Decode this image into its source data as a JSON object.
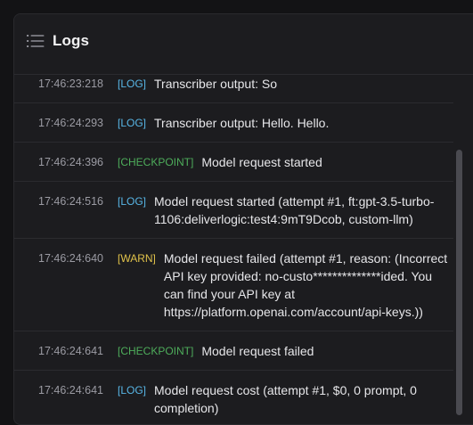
{
  "panel": {
    "title": "Logs",
    "icon": "list-icon"
  },
  "colors": {
    "log": "#58b6e6",
    "checkpoint": "#4ead5b",
    "warn": "#e0c24a"
  },
  "logs": [
    {
      "time": "17:46:23:218",
      "level": "[LOG]",
      "kind": "log",
      "message": "Transcriber output: So"
    },
    {
      "time": "17:46:24:293",
      "level": "[LOG]",
      "kind": "log",
      "message": "Transcriber output: Hello. Hello."
    },
    {
      "time": "17:46:24:396",
      "level": "[CHECKPOINT]",
      "kind": "checkpoint",
      "message": "Model request started"
    },
    {
      "time": "17:46:24:516",
      "level": "[LOG]",
      "kind": "log",
      "message": "Model request started (attempt #1, ft:gpt-3.5-turbo-1106:deliverlogic:test4:9mT9Dcob, custom-llm)"
    },
    {
      "time": "17:46:24:640",
      "level": "[WARN]",
      "kind": "warn",
      "message": "Model request failed (attempt #1, reason: (Incorrect API key provided: no-custo**************ided. You can find your API key at https://platform.openai.com/account/api-keys.))"
    },
    {
      "time": "17:46:24:641",
      "level": "[CHECKPOINT]",
      "kind": "checkpoint",
      "message": "Model request failed"
    },
    {
      "time": "17:46:24:641",
      "level": "[LOG]",
      "kind": "log",
      "message": "Model request cost (attempt #1, $0, 0 prompt, 0 completion)"
    }
  ]
}
